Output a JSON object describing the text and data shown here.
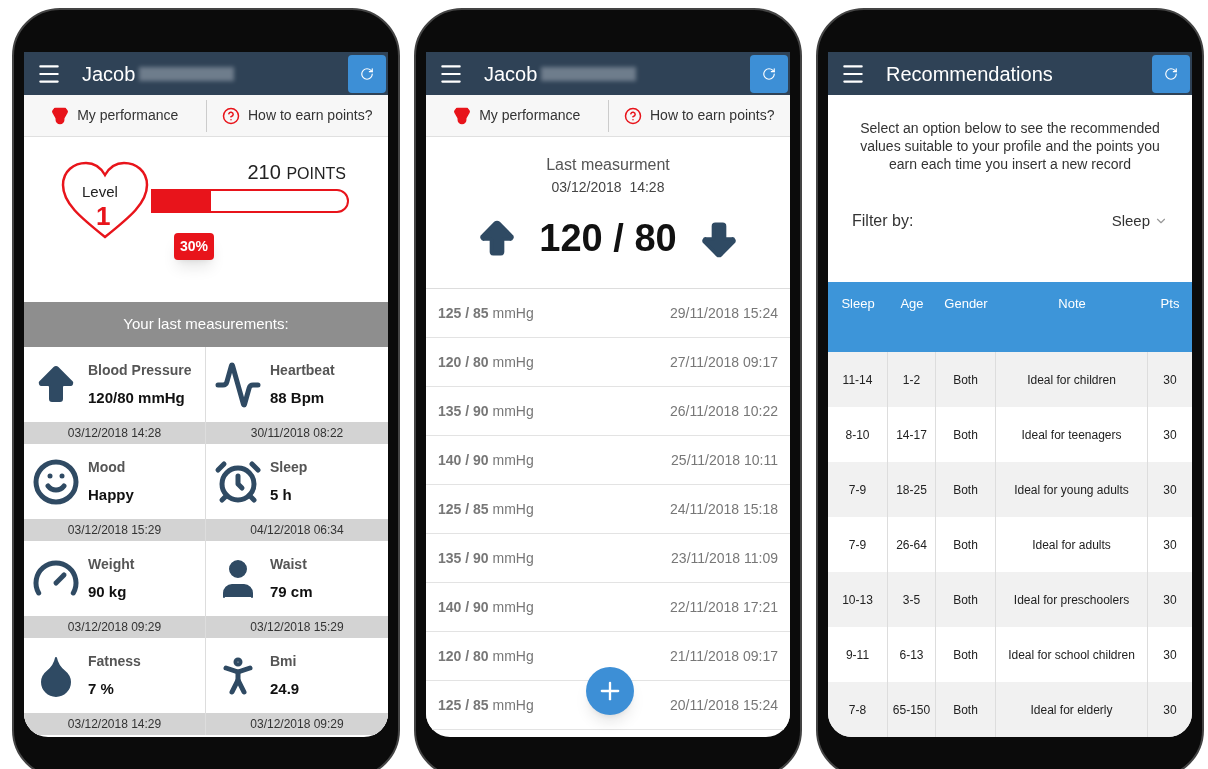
{
  "phones": [
    {
      "kind": "dashboard",
      "header": {
        "title": "Jacob",
        "surname_hidden": true
      },
      "tabs": [
        {
          "kind": "performance",
          "label": "My performance"
        },
        {
          "kind": "help",
          "label": "How to earn points?"
        }
      ],
      "progress": {
        "level_label": "Level",
        "level_number": "1",
        "points": "210",
        "points_unit": "POINTS",
        "level": 0.3,
        "percent": "30%"
      },
      "banner": "Your last measurements:",
      "measurements": [
        {
          "kind": "blood_pressure",
          "label": "Blood Pressure",
          "value": "120/80 mmHg",
          "date": "03/12/2018 14:28"
        },
        {
          "kind": "heartbeat",
          "label": "Heartbeat",
          "value": "88 Bpm",
          "date": "30/11/2018 08:22"
        },
        {
          "kind": "mood",
          "label": "Mood",
          "value": "Happy",
          "date": "03/12/2018 15:29"
        },
        {
          "kind": "sleep",
          "label": "Sleep",
          "value": "5 h",
          "date": "04/12/2018 06:34"
        },
        {
          "kind": "weight",
          "label": "Weight",
          "value": "90 kg",
          "date": "03/12/2018 09:29"
        },
        {
          "kind": "waist",
          "label": "Waist",
          "value": "79 cm",
          "date": "03/12/2018 15:29"
        },
        {
          "kind": "fatness",
          "label": "Fatness",
          "value": "7 %",
          "date": "03/12/2018 14:29"
        },
        {
          "kind": "bmi",
          "label": "Bmi",
          "value": "24.9",
          "date": "03/12/2018 09:29"
        }
      ]
    },
    {
      "kind": "history",
      "header": {
        "title": "Jacob",
        "surname_hidden": true
      },
      "tabs": [
        {
          "kind": "performance",
          "label": "My performance"
        },
        {
          "kind": "help",
          "label": "How to earn points?"
        }
      ],
      "last": {
        "title": "Last measurment",
        "datetime": "03/12/2018  14:28",
        "value": "120 / 80"
      },
      "records": [
        {
          "reading": "**125 / 85** mmHg",
          "date": "29/11/2018 15:24"
        },
        {
          "reading": "**120 / 80** mmHg",
          "date": "27/11/2018 09:17"
        },
        {
          "reading": "**135 / 90** mmHg",
          "date": "26/11/2018 10:22"
        },
        {
          "reading": "**140 / 90** mmHg",
          "date": "25/11/2018 10:11"
        },
        {
          "reading": "**125 / 85** mmHg",
          "date": "24/11/2018 15:18"
        },
        {
          "reading": "**135 / 90** mmHg",
          "date": "23/11/2018 11:09"
        },
        {
          "reading": "**140 / 90** mmHg",
          "date": "22/11/2018 17:21"
        },
        {
          "reading": "**120 / 80** mmHg",
          "date": "21/11/2018 09:17"
        },
        {
          "reading": "**125 / 85** mmHg",
          "date": "20/11/2018 15:24"
        }
      ]
    },
    {
      "kind": "recommendations",
      "header": {
        "title": "Recommendations",
        "surname_hidden": false
      },
      "intro": "Select an option below to see the recommended values suitable to your profile and the points you earn each time you insert a new record",
      "filter": {
        "label": "Filter by:",
        "value": "Sleep"
      },
      "table": {
        "columns": [
          "Sleep",
          "Age",
          "Gender",
          "Note",
          "Pts"
        ],
        "rows": [
          [
            "11-14",
            "1-2",
            "Both",
            "Ideal for children",
            "30"
          ],
          [
            "8-10",
            "14-17",
            "Both",
            "Ideal for teenagers",
            "30"
          ],
          [
            "7-9",
            "18-25",
            "Both",
            "Ideal for young adults",
            "30"
          ],
          [
            "7-9",
            "26-64",
            "Both",
            "Ideal for adults",
            "30"
          ],
          [
            "10-13",
            "3-5",
            "Both",
            "Ideal for preschoolers",
            "30"
          ],
          [
            "9-11",
            "6-13",
            "Both",
            "Ideal for school children",
            "30"
          ],
          [
            "7-8",
            "65-150",
            "Both",
            "Ideal for elderly",
            "30"
          ]
        ]
      }
    }
  ]
}
